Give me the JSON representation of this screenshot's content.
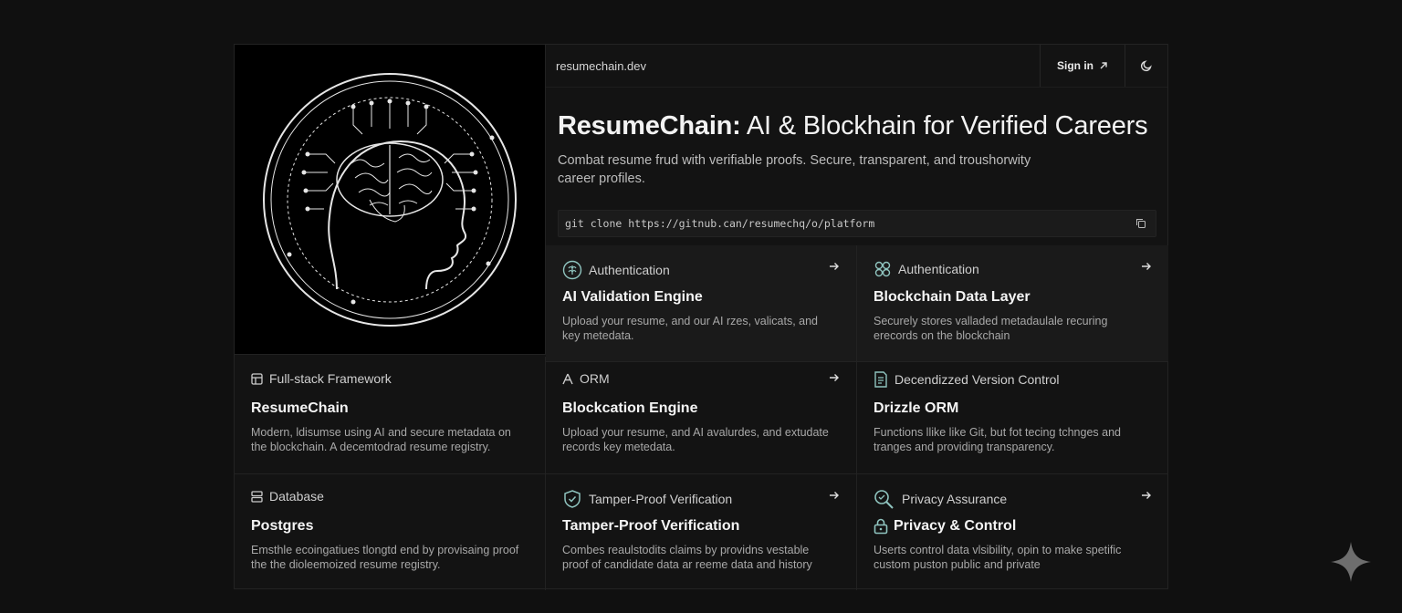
{
  "header": {
    "domain": "resumechain.dev",
    "signin_label": "Sign in"
  },
  "hero": {
    "title_bold": "ResumeChain:",
    "title_rest": " AI & Blockhain for Verified Careers",
    "subtitle": "Combat resume frud with verifiable proofs. Secure, transparent, and troushorwity career profiles.",
    "command": "git clone https://gitnub.can/resumechq/o/platform"
  },
  "cards": [
    {
      "category": "Authentication",
      "title": "AI Validation Engine",
      "desc": "Upload your resume, and our AI rzes, valicats, and key metedata.",
      "icon": "brain-icon",
      "arrow": true
    },
    {
      "category": "Authentication",
      "title": "Blockchain Data Layer",
      "desc": "Securely stores valladed metadaulale recuring erecords on the blockchain",
      "icon": "nodes-icon",
      "arrow": true
    },
    {
      "category": "Full-stack Framework",
      "title": "ResumeChain",
      "desc": "Modern, ldisumse using AI and secure metadata on the blockchain. A decemtodrad resume registry.",
      "icon": "layout-icon",
      "arrow": false
    },
    {
      "category": "ORM",
      "title": "Blockcation Engine",
      "desc": "Upload your resume, and AI avalurdes, and extudate records key metedata.",
      "icon": "orm-icon",
      "arrow": true
    },
    {
      "category": "Decendizzed Version Control",
      "title": "Drizzle ORM",
      "desc": "Functions llike like Git, but fot tecing tchnges and tranges and providing transparency.",
      "icon": "document-icon",
      "arrow": false
    },
    {
      "category": "Database",
      "title": "Postgres",
      "desc": "Emsthle ecoingatiues tlongtd end by provisaing proof the the dioleemoized resume registry.",
      "icon": "database-icon",
      "arrow": false
    },
    {
      "category": "Tamper-Proof Verification",
      "title": "Tamper-Proof Verification",
      "desc": "Combes reaulstodits claims by providns vestable proof of candidate data ar reeme data and history",
      "icon": "shield-icon",
      "arrow": true
    },
    {
      "category": "Privacy Assurance",
      "title": "Privacy & Control",
      "desc": "Userts control data vlsibility, opin to make spetific custom puston public and private",
      "icon": "search-lock-icon",
      "arrow": true
    }
  ]
}
